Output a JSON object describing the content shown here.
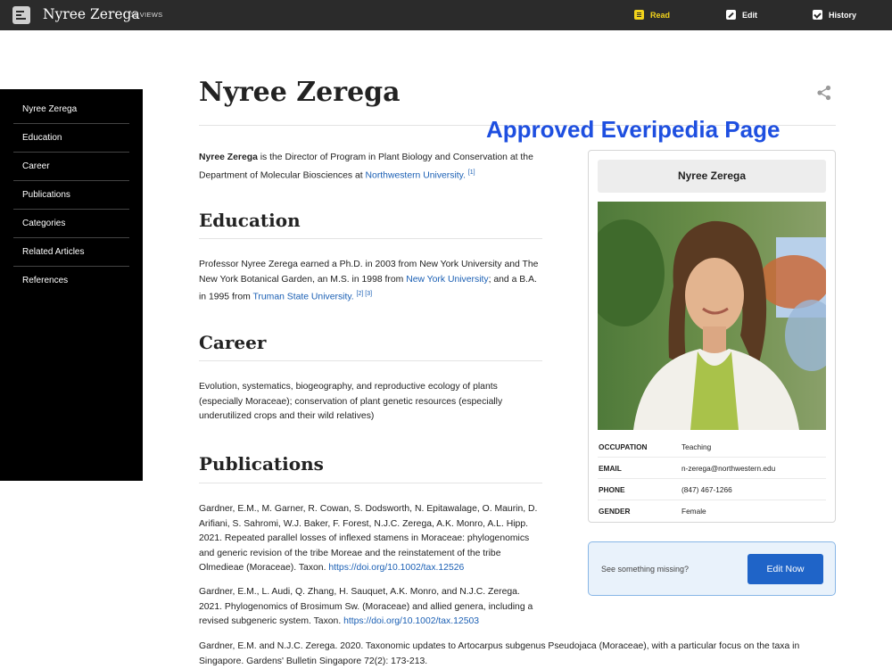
{
  "topbar": {
    "title": "Nyree Zerega",
    "views": "11 VIEWS",
    "read_label": "Read",
    "edit_label": "Edit",
    "history_label": "History",
    "accent_color": "#f2d31b"
  },
  "sidebar": {
    "items": [
      {
        "label": "Nyree Zerega"
      },
      {
        "label": "Education"
      },
      {
        "label": "Career"
      },
      {
        "label": "Publications"
      },
      {
        "label": "Categories"
      },
      {
        "label": "Related Articles"
      },
      {
        "label": "References"
      }
    ]
  },
  "watermark": "Approved Everipedia Page",
  "article": {
    "title": "Nyree Zerega",
    "intro": {
      "name": "Nyree Zerega",
      "text": " is the Director of Program in Plant Biology and Conservation at the Department of Molecular Biosciences at ",
      "link": "Northwestern University.",
      "ref": "[1]"
    },
    "education": {
      "heading": "Education",
      "text1": "Professor Nyree Zerega earned a Ph.D. in 2003 from New York University and The New York Botanical Garden, an M.S. in 1998 from ",
      "link1": "New York University",
      "text2": "; and a B.A. in 1995 from ",
      "link2": "Truman State University.",
      "refs": "[2] [3]"
    },
    "career": {
      "heading": "Career",
      "text": "Evolution, systematics, biogeography, and reproductive ecology of plants (especially Moraceae); conservation of plant genetic resources (especially underutilized crops and their wild relatives)"
    },
    "publications": {
      "heading": "Publications",
      "items": [
        {
          "text": "Gardner, E.M., M. Garner, R. Cowan, S. Dodsworth, N. Epitawalage, O. Maurin, D. Arifiani, S. Sahromi, W.J.  Baker, F. Forest, N.J.C.  Zerega, A.K.  Monro, A.L.  Hipp. 2021.  Repeated parallel losses of inflexed stamens in Moraceae: phylogenomics and generic revision of the tribe Moreae and the reinstatement of the tribe Olmedieae (Moraceae).  Taxon.  ",
          "link": "https://doi.org/10.1002/tax.12526"
        },
        {
          "text": "Gardner, E.M., L. Audi, Q. Zhang, H. Sauquet, A.K.  Monro, and N.J.C.  Zerega. 2021.  Phylogenomics of Brosimum Sw.  (Moraceae) and allied genera, including a revised subgeneric system.  Taxon.  ",
          "link": "https://doi.org/10.1002/tax.12503"
        },
        {
          "text": "Gardner, E.M. and N.J.C.  Zerega. 2020. Taxonomic updates to Artocarpus subgenus Pseudojaca (Moraceae), with a particular focus on the taxa in Singapore.  Gardens' Bulletin Singapore 72(2): 173-213.",
          "link": ""
        }
      ]
    }
  },
  "infobox": {
    "name": "Nyree Zerega",
    "rows": [
      {
        "key": "OCCUPATION",
        "value": "Teaching"
      },
      {
        "key": "EMAIL",
        "value": "n-zerega@northwestern.edu"
      },
      {
        "key": "PHONE",
        "value": "(847) 467-1266"
      },
      {
        "key": "GENDER",
        "value": "Female"
      }
    ]
  },
  "missing_box": {
    "text": "See something missing?",
    "button_label": "Edit Now"
  },
  "icons": {
    "menu": "menu-icon",
    "read": "read-icon",
    "edit": "edit-icon",
    "history": "history-icon",
    "share": "share-icon"
  }
}
